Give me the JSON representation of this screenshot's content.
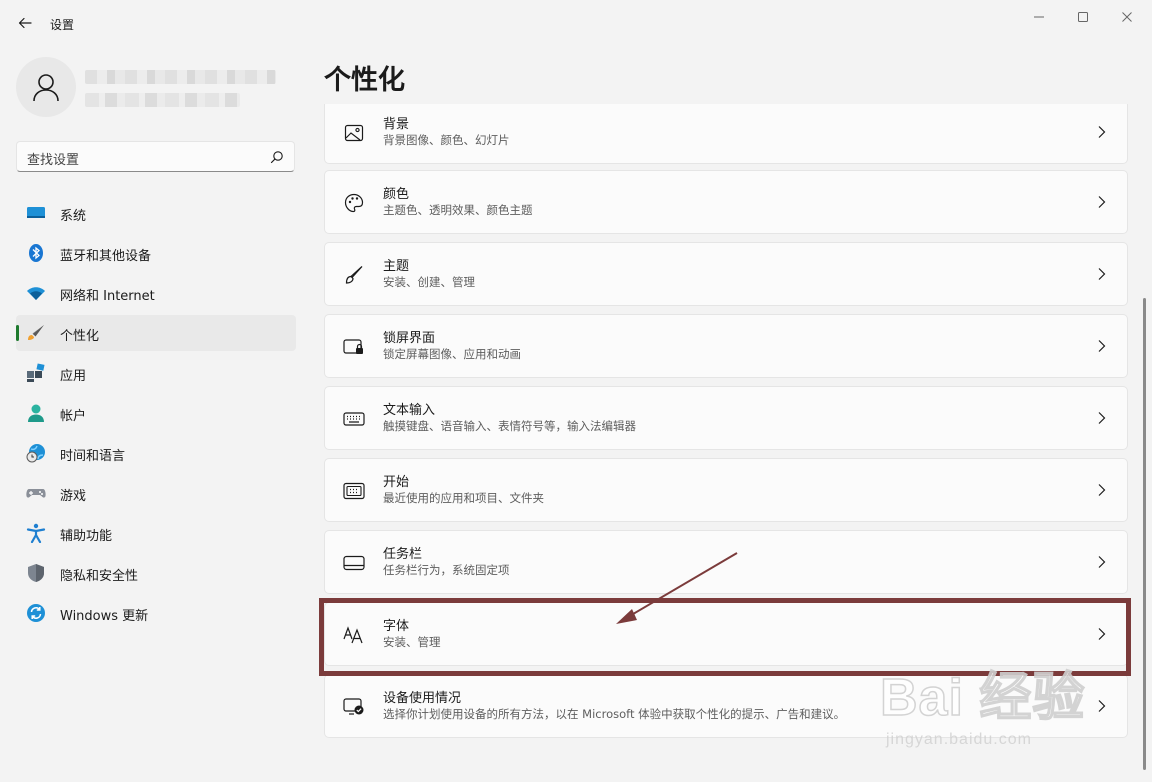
{
  "titlebar": {
    "title": "设置"
  },
  "sidebar": {
    "search": {
      "placeholder": "查找设置"
    },
    "items": [
      {
        "label": "系统",
        "icon": "system-icon"
      },
      {
        "label": "蓝牙和其他设备",
        "icon": "bluetooth-icon"
      },
      {
        "label": "网络和 Internet",
        "icon": "wifi-icon"
      },
      {
        "label": "个性化",
        "icon": "brush-icon",
        "active": true
      },
      {
        "label": "应用",
        "icon": "apps-icon"
      },
      {
        "label": "帐户",
        "icon": "account-icon"
      },
      {
        "label": "时间和语言",
        "icon": "globe-clock-icon"
      },
      {
        "label": "游戏",
        "icon": "gamepad-icon"
      },
      {
        "label": "辅助功能",
        "icon": "accessibility-icon"
      },
      {
        "label": "隐私和安全性",
        "icon": "shield-icon"
      },
      {
        "label": "Windows 更新",
        "icon": "update-icon"
      }
    ]
  },
  "main": {
    "title": "个性化",
    "cards": [
      {
        "title": "背景",
        "subtitle": "背景图像、颜色、幻灯片",
        "icon": "image-icon"
      },
      {
        "title": "颜色",
        "subtitle": "主题色、透明效果、颜色主题",
        "icon": "palette-icon"
      },
      {
        "title": "主题",
        "subtitle": "安装、创建、管理",
        "icon": "brush-icon"
      },
      {
        "title": "锁屏界面",
        "subtitle": "锁定屏幕图像、应用和动画",
        "icon": "lock-screen-icon"
      },
      {
        "title": "文本输入",
        "subtitle": "触摸键盘、语音输入、表情符号等，输入法编辑器",
        "icon": "keyboard-icon"
      },
      {
        "title": "开始",
        "subtitle": "最近使用的应用和项目、文件夹",
        "icon": "start-icon"
      },
      {
        "title": "任务栏",
        "subtitle": "任务栏行为，系统固定项",
        "icon": "taskbar-icon"
      },
      {
        "title": "字体",
        "subtitle": "安装、管理",
        "icon": "fonts-icon",
        "highlighted": true
      },
      {
        "title": "设备使用情况",
        "subtitle": "选择你计划使用设备的所有方法，以在 Microsoft 体验中获取个性化的提示、广告和建议。",
        "icon": "device-usage-icon"
      }
    ]
  },
  "annotation": {
    "box_color": "#7b3b3b",
    "arrow_color": "#7b3b3b"
  },
  "watermark": {
    "main": "Bai 经验",
    "sub": "jingyan.baidu.com"
  },
  "colors": {
    "accent": "#0067c0",
    "active_indicator": "#1e7a2e",
    "background": "#f3f3f3",
    "card": "#fbfbfb"
  }
}
